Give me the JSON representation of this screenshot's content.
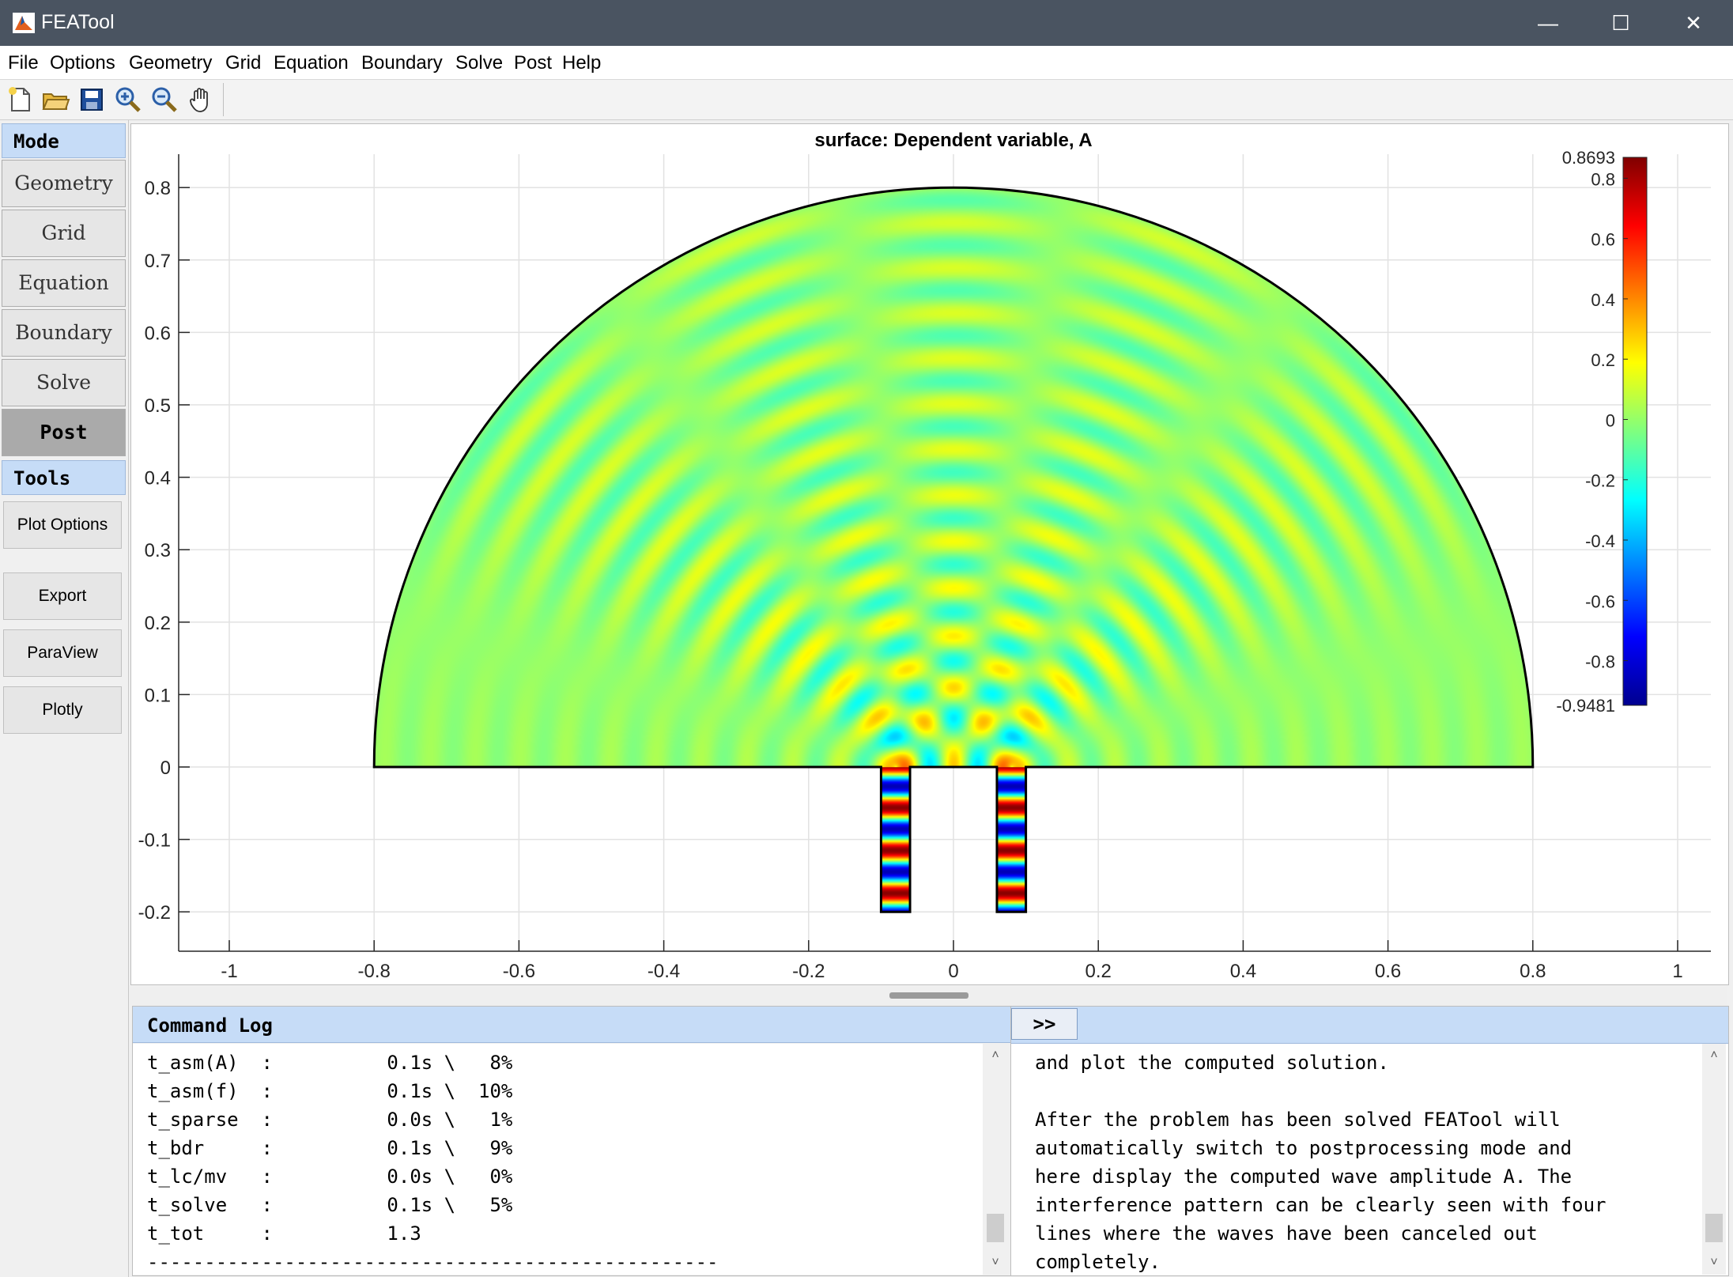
{
  "window": {
    "title": "FEATool",
    "minimize_glyph": "—",
    "maximize_glyph": "☐",
    "close_glyph": "✕"
  },
  "menu": [
    "File",
    "Options",
    "Geometry",
    "Grid",
    "Equation",
    "Boundary",
    "Solve",
    "Post",
    "Help"
  ],
  "toolbar": [
    "new-file-icon",
    "open-folder-icon",
    "save-icon",
    "zoom-in-icon",
    "zoom-out-icon",
    "pan-hand-icon"
  ],
  "sidebar": {
    "mode_header": "Mode",
    "modes": [
      "Geometry",
      "Grid",
      "Equation",
      "Boundary",
      "Solve",
      "Post"
    ],
    "active_mode": "Post",
    "tools_header": "Tools",
    "tools": [
      "Plot Options",
      "Export",
      "ParaView",
      "Plotly"
    ]
  },
  "chart_data": {
    "type": "heatmap",
    "title": "surface: Dependent variable, A",
    "xlabel": "",
    "ylabel": "",
    "xlim": [
      -1,
      1
    ],
    "ylim": [
      -0.25,
      0.85
    ],
    "x_ticks": [
      "-1",
      "-0.8",
      "-0.6",
      "-0.4",
      "-0.2",
      "0",
      "0.2",
      "0.4",
      "0.6",
      "0.8",
      "1"
    ],
    "y_ticks": [
      "0.8",
      "0.7",
      "0.6",
      "0.5",
      "0.4",
      "0.3",
      "0.2",
      "0.1",
      "0",
      "-0.1",
      "-0.2"
    ],
    "grid": true,
    "domain": {
      "semicircle": {
        "center": [
          0,
          0
        ],
        "radius": 0.8
      },
      "channels": [
        {
          "x": [
            -0.1,
            -0.06
          ],
          "y": [
            -0.2,
            0
          ]
        },
        {
          "x": [
            0.06,
            0.1
          ],
          "y": [
            -0.2,
            0
          ]
        }
      ],
      "sources_x": [
        -0.08,
        0.08
      ]
    },
    "colorbar": {
      "max_label": "0.8693",
      "min_label": "-0.9481",
      "ticks": [
        "0.8",
        "0.6",
        "0.4",
        "0.2",
        "0",
        "-0.2",
        "-0.4",
        "-0.6",
        "-0.8"
      ],
      "min": -0.9481,
      "max": 0.8693,
      "colormap": "jet"
    }
  },
  "command_log": {
    "title": "Command Log",
    "lines": [
      "t_asm(A)  :          0.1s \\   8%",
      "t_asm(f)  :          0.1s \\  10%",
      "t_sparse  :          0.0s \\   1%",
      "t_bdr     :          0.1s \\   9%",
      "t_lc/mv   :          0.0s \\   0%",
      "t_solve   :          0.1s \\   5%",
      "t_tot     :          1.3",
      "--------------------------------------------------"
    ]
  },
  "help": {
    "button": ">>",
    "lines": [
      "and plot the computed solution.",
      "",
      "After the problem has been solved FEATool will",
      "automatically switch to postprocessing mode and",
      "here display the computed wave amplitude A. The",
      "interference pattern can be clearly seen with four",
      "lines where the waves have been canceled out",
      "completely."
    ]
  },
  "scrollbar": {
    "up_arrow": "˄",
    "down_arrow": "˅"
  },
  "colors": {
    "titlebar": "#4a5461",
    "panel_header": "#c6dcf7",
    "active_mode": "#aaaaaa"
  }
}
